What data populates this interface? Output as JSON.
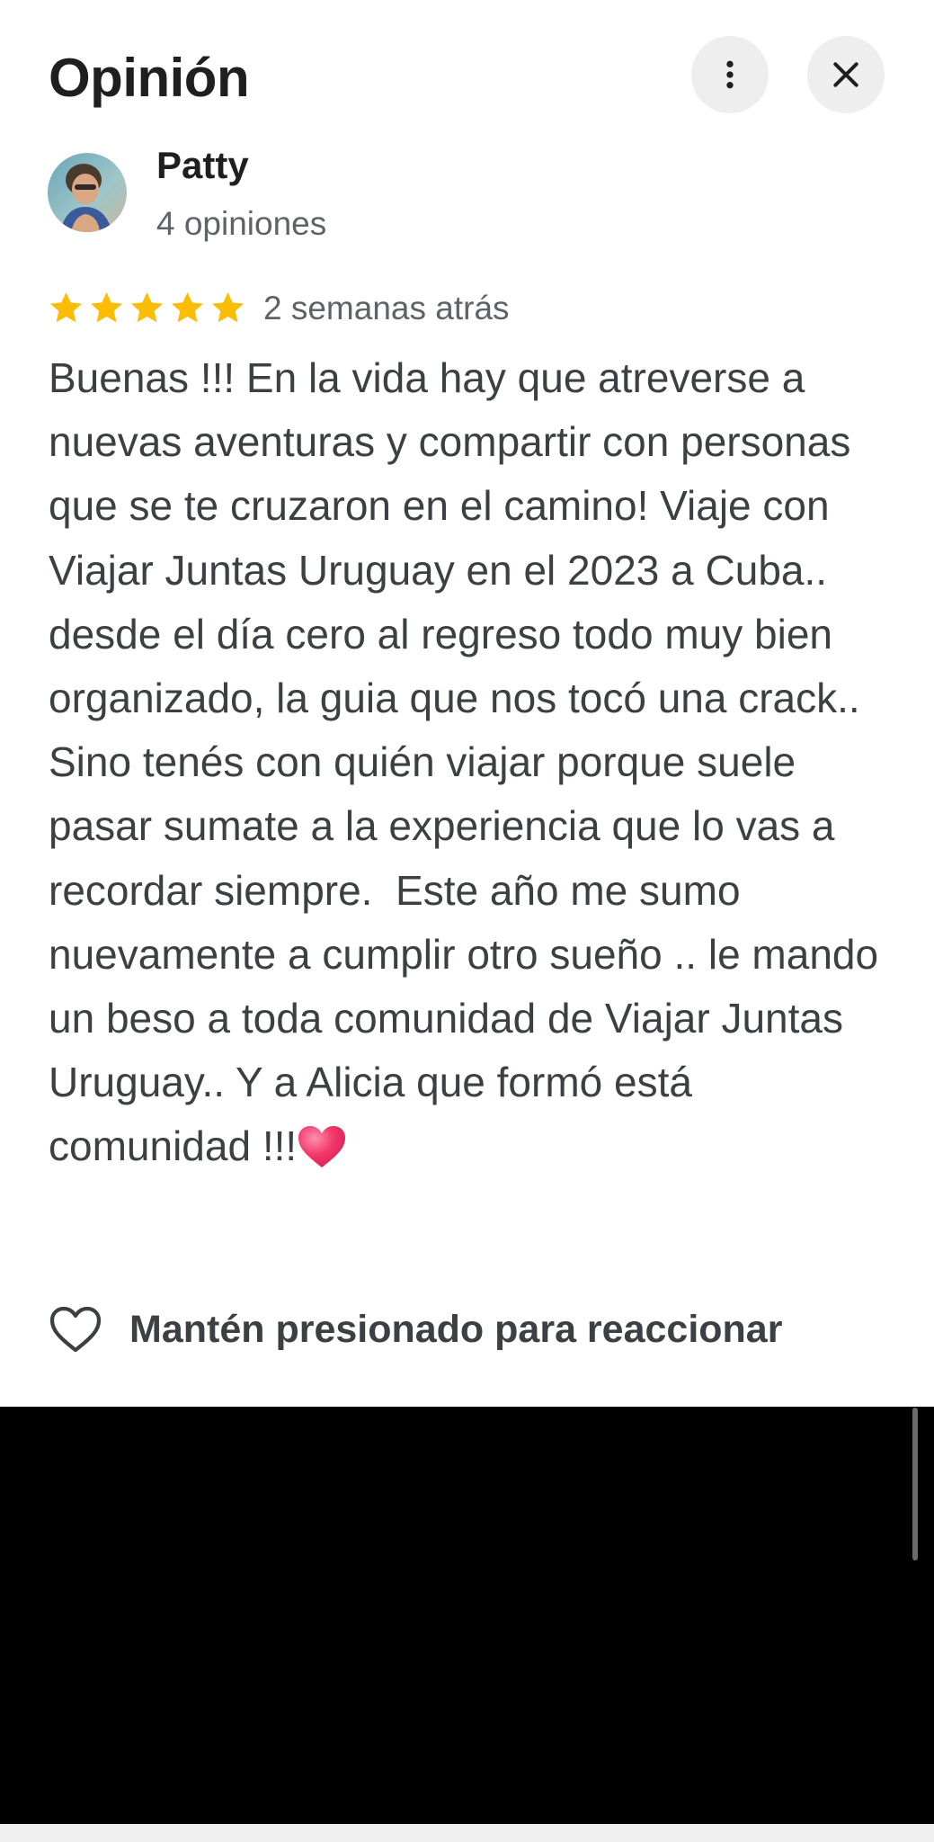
{
  "header": {
    "title": "Opinión",
    "more_icon": "more-vert-icon",
    "close_icon": "close-icon"
  },
  "author": {
    "name": "Patty",
    "meta": "4 opiniones"
  },
  "review": {
    "rating": 5,
    "rating_max": 5,
    "date": "2 semanas atrás",
    "text": "Buenas !!! En la vida hay que atreverse a nuevas aventuras y compartir con personas que se te cruzaron en el camino! Viaje con Viajar Juntas Uruguay en el 2023 a Cuba.. desde el día cero al regreso todo muy bien organizado, la guia que nos tocó una crack.. Sino tenés con quién viajar porque suele pasar sumate a la experiencia que lo vas a recordar siempre.  Este año me sumo nuevamente a cumplir otro sueño .. le mando un beso a toda comunidad de Viajar Juntas Uruguay.. Y a Alicia que formó está comunidad !!!",
    "text_emoji": "red-heart-emoji"
  },
  "reaction": {
    "label": "Mantén presionado para reaccionar",
    "icon": "heart-outline-icon"
  },
  "colors": {
    "star": "#fbbc04",
    "title_text": "#1f1f1f",
    "secondary_text": "#5f6368",
    "body_text": "#3c4043",
    "button_bg": "#eeeeee"
  }
}
